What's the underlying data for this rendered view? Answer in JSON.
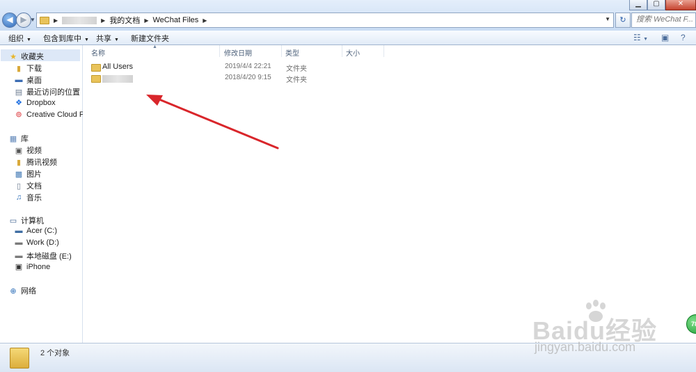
{
  "window": {
    "minimize": "▁",
    "maximize": "▢",
    "close": "✕"
  },
  "address": {
    "crumb_1": "我的文档",
    "crumb_2": "WeChat Files"
  },
  "search": {
    "placeholder": "搜索 WeChat F..."
  },
  "toolbar": {
    "organize": "组织",
    "include_library": "包含到库中",
    "share": "共享",
    "new_folder": "新建文件夹"
  },
  "sidebar": {
    "favorites": {
      "header": "收藏夹",
      "items": [
        "下载",
        "桌面",
        "最近访问的位置",
        "Dropbox",
        "Creative Cloud File"
      ]
    },
    "libraries": {
      "header": "库",
      "items": [
        "视频",
        "腾讯视频",
        "图片",
        "文档",
        "音乐"
      ]
    },
    "computer": {
      "header": "计算机",
      "items": [
        "Acer (C:)",
        "Work (D:)",
        "本地磁盘 (E:)",
        "iPhone"
      ]
    },
    "network": {
      "header": "网络"
    }
  },
  "columns": {
    "name": "名称",
    "modified": "修改日期",
    "type": "类型",
    "size": "大小"
  },
  "files": [
    {
      "name": "All Users",
      "modified": "2019/4/4 22:21",
      "type": "文件夹"
    },
    {
      "name": "",
      "modified": "2018/4/20 9:15",
      "type": "文件夹"
    }
  ],
  "status": {
    "count": "2 个对象"
  },
  "watermark": {
    "brand": "Baidu经验",
    "url": "jingyan.baidu.com",
    "badge": "78"
  },
  "colors": {
    "arrow": "#d9262b",
    "selection": "#dde8f7"
  }
}
